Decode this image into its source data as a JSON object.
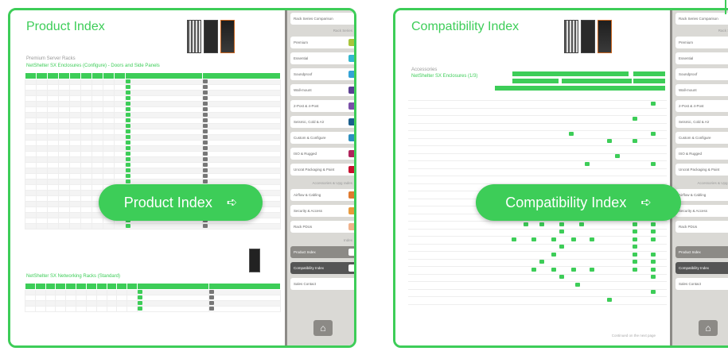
{
  "cards": [
    {
      "title": "Product Index",
      "subtitle": "Premium Server Racks",
      "subheading": "NetShelter SX Enclosures (Configure) - Doors and Side Panels",
      "section2": "NetShelter SX Networking Racks (Standard)",
      "button": "Product Index",
      "icon": "arrow-right-icon"
    },
    {
      "title": "Compatibility Index",
      "subtitle": "Accessories",
      "subheading": "NetShelter SX Enclosures (1/3)",
      "note": "Continued on the next page",
      "button": "Compatibility Index",
      "icon": "arrow-right-icon"
    }
  ],
  "sidebar": {
    "top": "Rack Series Comparison",
    "header1": "Rack Series",
    "series": [
      {
        "label": "Premium",
        "color": "#a8c43b"
      },
      {
        "label": "Essential",
        "color": "#34b7cf"
      },
      {
        "label": "Soundproof",
        "color": "#34a3d6"
      },
      {
        "label": "Wall-mount",
        "color": "#5b3f92"
      },
      {
        "label": "2-Post & 4-Post",
        "color": "#7a4fa8"
      },
      {
        "label": "Seismic, Cold & Air",
        "color": "#1b5e8c"
      },
      {
        "label": "Custom & Configure",
        "color": "#2d8fbf"
      },
      {
        "label": "ISO & Rugged",
        "color": "#b0245c"
      },
      {
        "label": "Uncrat Packaging & Paint",
        "color": "#c8102e"
      }
    ],
    "header2": "Accessories & Upg rades",
    "accessories": [
      {
        "label": "Airflow & Cabling",
        "color": "#e07a2f"
      },
      {
        "label": "Security & Access",
        "color": "#e89a3c"
      },
      {
        "label": "Rack PDUs",
        "color": "#f0b28c"
      }
    ],
    "header3": "Index",
    "index": [
      "Product Index",
      "Compatibility Index"
    ],
    "contact": "Sales Contact"
  },
  "colors": {
    "accent": "#3dcd58",
    "sidebar": "#dad9d5",
    "dark": "#8c8a86"
  }
}
